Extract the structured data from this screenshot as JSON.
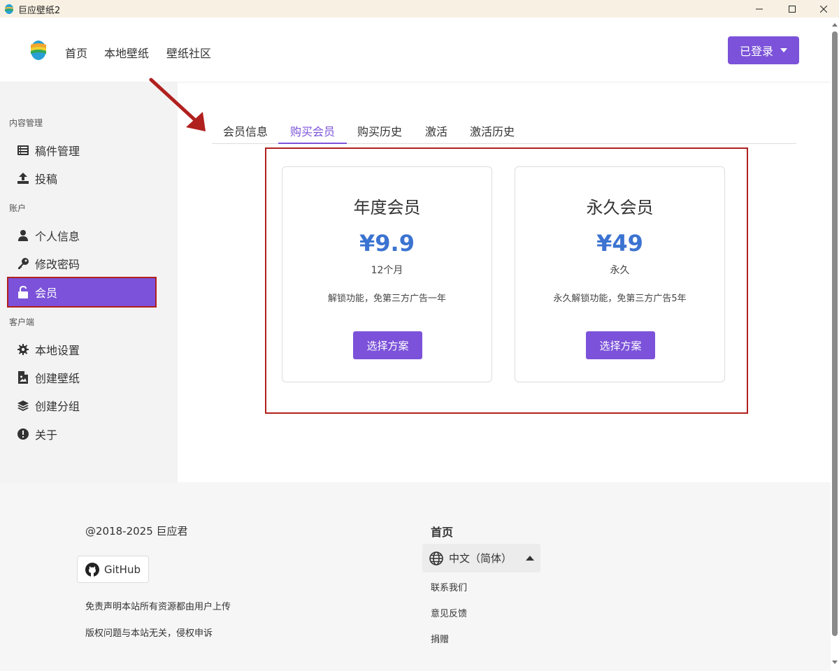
{
  "window": {
    "title": "巨应壁纸2"
  },
  "header": {
    "nav": [
      "首页",
      "本地壁纸",
      "壁纸社区"
    ],
    "login_label": "已登录"
  },
  "sidebar": {
    "groups": [
      "内容管理",
      "账户",
      "客户端"
    ],
    "items": [
      {
        "label": "稿件管理",
        "icon": "list-icon"
      },
      {
        "label": "投稿",
        "icon": "upload-icon"
      },
      {
        "label": "个人信息",
        "icon": "user-icon"
      },
      {
        "label": "修改密码",
        "icon": "key-icon"
      },
      {
        "label": "会员",
        "icon": "unlock-icon",
        "active": true
      },
      {
        "label": "本地设置",
        "icon": "gear-icon"
      },
      {
        "label": "创建壁纸",
        "icon": "image-file-icon"
      },
      {
        "label": "创建分组",
        "icon": "layers-icon"
      },
      {
        "label": "关于",
        "icon": "info-icon"
      }
    ]
  },
  "tabs": [
    "会员信息",
    "购买会员",
    "购买历史",
    "激活",
    "激活历史"
  ],
  "active_tab": "购买会员",
  "plans": [
    {
      "title": "年度会员",
      "price": "¥9.9",
      "period": "12个月",
      "desc": "解锁功能，免第三方广告一年",
      "button": "选择方案"
    },
    {
      "title": "永久会员",
      "price": "¥49",
      "period": "永久",
      "desc": "永久解锁功能，免第三方广告5年",
      "button": "选择方案"
    }
  ],
  "footer": {
    "copyright": "@2018-2025 巨应君",
    "github": "GitHub",
    "disclaimer_1": "免责声明本站所有资源都由用户上传",
    "disclaimer_2": "版权问题与本站无关，侵权申诉",
    "home": "首页",
    "language": "中文（简体）",
    "links": [
      "联系我们",
      "意见反馈",
      "捐赠"
    ]
  },
  "colors": {
    "accent": "#7b52d9",
    "price": "#3b73d1",
    "annotation_red": "#b0201e"
  }
}
